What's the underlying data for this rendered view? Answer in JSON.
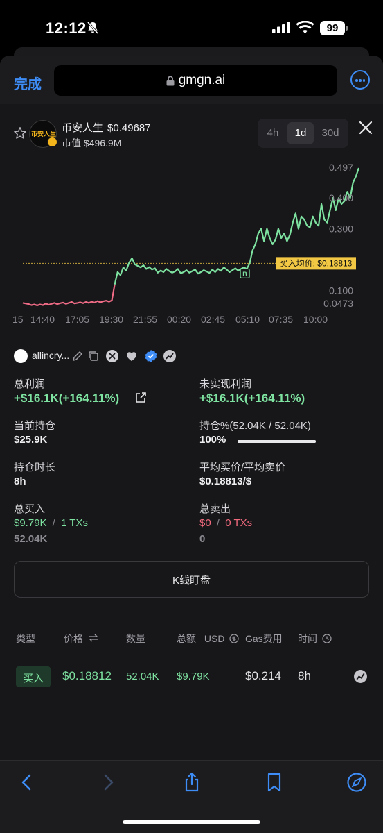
{
  "status_bar": {
    "time": "12:12",
    "battery": "99"
  },
  "browser": {
    "done_label": "完成",
    "url": "gmgn.ai"
  },
  "token": {
    "name": "币安人生",
    "price": "$0.49687",
    "market_cap": "市值 $496.9M",
    "logo_text": "币安人生"
  },
  "timeframes": [
    {
      "label": "4h",
      "active": false
    },
    {
      "label": "1d",
      "active": true
    },
    {
      "label": "30d",
      "active": false
    }
  ],
  "chart_data": {
    "type": "line",
    "y_tick_labels": [
      "0.497",
      "0.400",
      "0.300",
      "0.100",
      "0.0473"
    ],
    "x_tick_labels": [
      "15",
      "14:40",
      "17:05",
      "19:30",
      "21:55",
      "00:20",
      "02:45",
      "05:10",
      "07:35",
      "10:00"
    ],
    "avg_buy_line_value": 0.18813,
    "avg_buy_label": "买入均价: $0.18813",
    "buy_marker_label": "B",
    "series": [
      {
        "color_below_avg": "#ef6b86",
        "color_above_avg": "#7ee2a0",
        "values": [
          0.06,
          0.058,
          0.056,
          0.053,
          0.055,
          0.052,
          0.055,
          0.053,
          0.058,
          0.054,
          0.057,
          0.06,
          0.056,
          0.059,
          0.061,
          0.057,
          0.06,
          0.063,
          0.058,
          0.06,
          0.062,
          0.059,
          0.063,
          0.06,
          0.064,
          0.061,
          0.066,
          0.062,
          0.065,
          0.067,
          0.064,
          0.068,
          0.12,
          0.16,
          0.15,
          0.175,
          0.165,
          0.19,
          0.205,
          0.185,
          0.18,
          0.175,
          0.182,
          0.17,
          0.176,
          0.168,
          0.172,
          0.158,
          0.165,
          0.16,
          0.17,
          0.163,
          0.158,
          0.162,
          0.17,
          0.156,
          0.16,
          0.166,
          0.158,
          0.163,
          0.168,
          0.155,
          0.16,
          0.166,
          0.162,
          0.157,
          0.168,
          0.16,
          0.17,
          0.164,
          0.175,
          0.168,
          0.16,
          0.166,
          0.172,
          0.165,
          0.17,
          0.175,
          0.17,
          0.188,
          0.23,
          0.25,
          0.285,
          0.3,
          0.26,
          0.3,
          0.27,
          0.25,
          0.265,
          0.3,
          0.27,
          0.285,
          0.26,
          0.28,
          0.32,
          0.35,
          0.3,
          0.34,
          0.33,
          0.31,
          0.305,
          0.34,
          0.32,
          0.31,
          0.38,
          0.33,
          0.32,
          0.36,
          0.4,
          0.36,
          0.4,
          0.38,
          0.39,
          0.42,
          0.4,
          0.45,
          0.47,
          0.497
        ]
      }
    ]
  },
  "wallet": {
    "name": "allincry..."
  },
  "stats": {
    "total_profit_label": "总利润",
    "total_profit_value": "+$16.1K(+164.11%)",
    "unrealized_label": "未实现利润",
    "unrealized_value": "+$16.1K(+164.11%)",
    "holding_label": "当前持仓",
    "holding_value": "$25.9K",
    "holding_pct_label": "持仓%(52.04K / 52.04K)",
    "holding_pct_value": "100%",
    "holding_pct_fraction": 1.0,
    "duration_label": "持仓时长",
    "duration_value": "8h",
    "avg_price_label": "平均买价/平均卖价",
    "avg_price_value": "$0.18813/$",
    "total_buy_label": "总买入",
    "total_buy_amount": "$9.79K",
    "total_buy_sep": "/",
    "total_buy_txs": "1 TXs",
    "total_buy_qty": "52.04K",
    "total_sell_label": "总卖出",
    "total_sell_amount": "$0",
    "total_sell_sep": "/",
    "total_sell_txs": "0 TXs",
    "total_sell_qty": "0"
  },
  "kline_button": "K线盯盘",
  "table": {
    "headers": {
      "type": "类型",
      "price": "价格",
      "quantity": "数量",
      "total": "总额",
      "usd": "USD",
      "gas": "Gas费用",
      "time": "时间"
    },
    "rows": [
      {
        "type": "买入",
        "price": "$0.18812",
        "quantity": "52.04K",
        "total": "$9.79K",
        "gas": "$0.214",
        "time": "8h"
      }
    ]
  },
  "colors": {
    "accent_blue": "#3e8cf5",
    "profit_green": "#7ee2a0",
    "loss_red": "#f0697c",
    "avg_line_yellow": "#f2c744"
  }
}
